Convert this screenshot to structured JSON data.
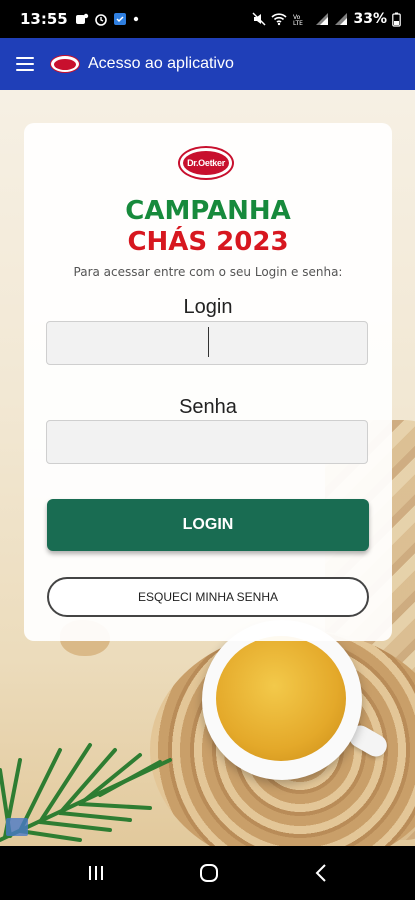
{
  "status_bar": {
    "time": "13:55",
    "battery_pct": "33%",
    "left_icons": [
      "teams-icon",
      "alarm-icon",
      "app-notification-icon",
      "dot-icon"
    ],
    "right_icons": [
      "mute-icon",
      "wifi-icon",
      "volte-icon",
      "signal-icon",
      "signal-icon-2"
    ]
  },
  "app_bar": {
    "title": "Acesso ao aplicativo",
    "background": "#1f3fb8"
  },
  "card": {
    "brand_logo_text": "Dr.Oetker",
    "title_line1": "CAMPANHA",
    "title_line2": "CHÁS 2023",
    "instructions": "Para acessar entre com o seu Login e senha:",
    "login_label": "Login",
    "login_value": "",
    "password_label": "Senha",
    "password_value": "",
    "login_button": "LOGIN",
    "forgot_button": "ESQUECI MINHA SENHA"
  },
  "colors": {
    "title_green": "#178a3c",
    "title_red": "#d7171f",
    "login_button_bg": "#196c52"
  }
}
